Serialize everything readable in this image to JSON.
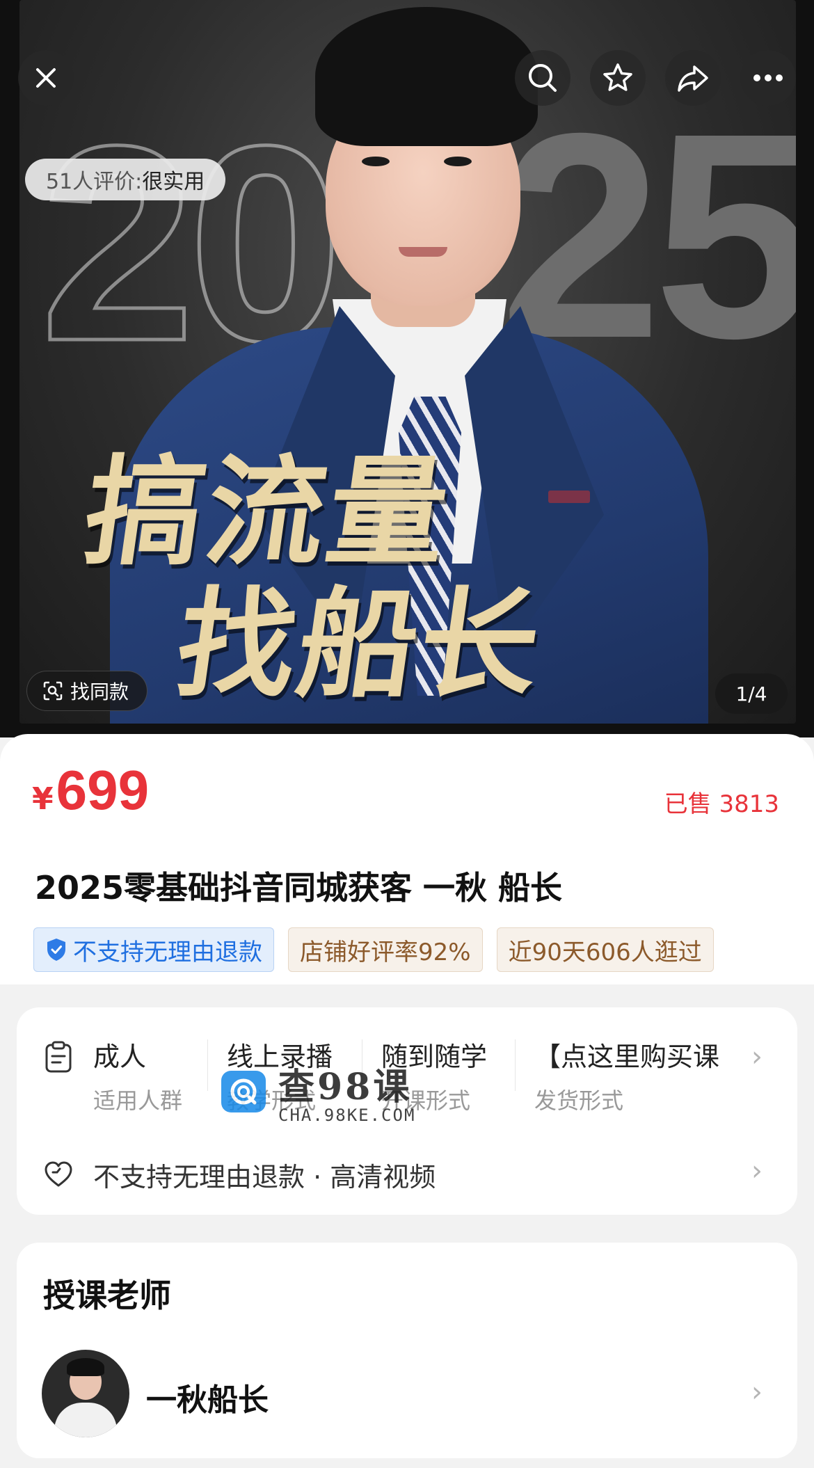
{
  "hero": {
    "reviews_count_label": "51人评价:",
    "reviews_summary": "很实用",
    "similar_label": "找同款",
    "page_indicator": "1/4",
    "poster_year_left": "20",
    "poster_year_right": "25",
    "poster_slogan_line1": "搞流量",
    "poster_slogan_line2": "找船长",
    "icons": [
      "close-icon",
      "search-icon",
      "star-icon",
      "share-icon",
      "more-icon"
    ]
  },
  "product": {
    "currency": "¥",
    "price": "699",
    "sold": "已售 3813",
    "title": "2025零基础抖音同城获客 一秋 船长",
    "tags": [
      {
        "text": "不支持无理由退款",
        "style": "blue"
      },
      {
        "text": "店铺好评率92%",
        "style": "brown"
      },
      {
        "text": "近90天606人逛过",
        "style": "brown"
      }
    ]
  },
  "attributes": {
    "items": [
      {
        "value": "成人",
        "key": "适用人群"
      },
      {
        "value": "线上录播",
        "key": "教学形式"
      },
      {
        "value": "随到随学",
        "key": "开课形式"
      },
      {
        "value": "【点这里购买课",
        "key": "发货形式"
      }
    ],
    "policy": "不支持无理由退款 · 高清视频"
  },
  "watermark": {
    "cn": "查98课",
    "en": "CHA.98KE.COM"
  },
  "teacher": {
    "heading": "授课老师",
    "name": "一秋船长"
  },
  "colors": {
    "price_red": "#e8333a",
    "tag_blue": "#1f6fe0",
    "tag_brown": "#8c5a2b"
  }
}
